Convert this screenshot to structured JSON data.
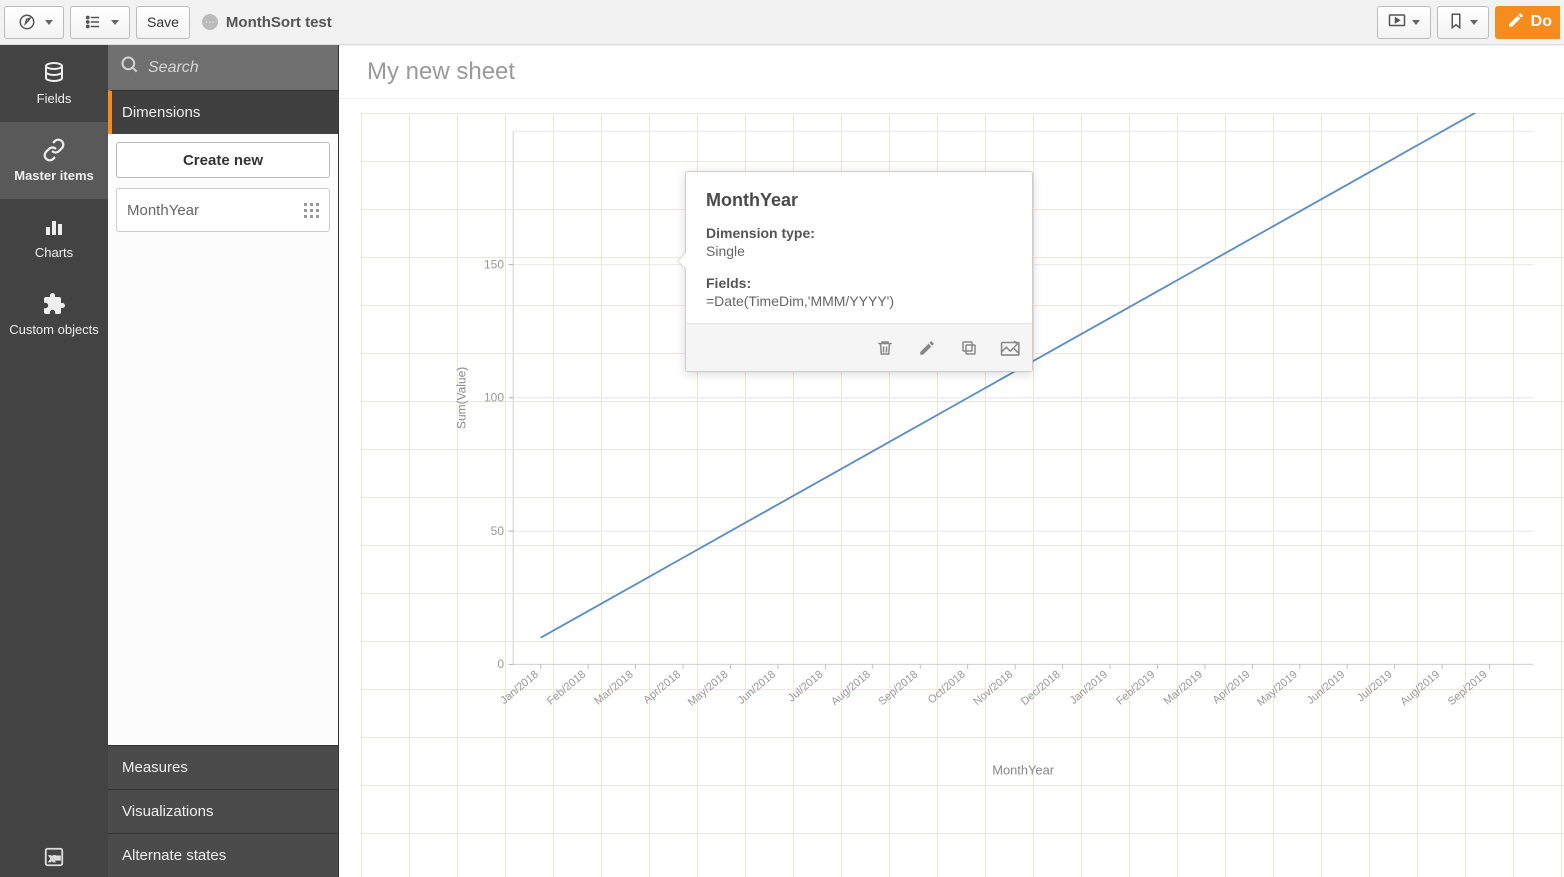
{
  "toolbar": {
    "save_label": "Save",
    "app_title": "MonthSort test",
    "done_label": "Do"
  },
  "iconbar": {
    "fields": "Fields",
    "master_items": "Master items",
    "charts": "Charts",
    "custom_objects": "Custom objects"
  },
  "assetpanel": {
    "search_placeholder": "Search",
    "dimensions_head": "Dimensions",
    "create_new_label": "Create new",
    "dim_item_label": "MonthYear",
    "measures_head": "Measures",
    "visualizations_head": "Visualizations",
    "alternate_states_head": "Alternate states"
  },
  "popover": {
    "title": "MonthYear",
    "type_label": "Dimension type:",
    "type_value": "Single",
    "fields_label": "Fields:",
    "fields_value": "=Date(TimeDim,'MMM/YYYY')"
  },
  "sheet": {
    "title": "My new sheet"
  },
  "chart_data": {
    "type": "line",
    "title": "",
    "xlabel": "MonthYear",
    "ylabel": "Sum(Value)",
    "ylim": [
      0,
      200
    ],
    "yticks": [
      0,
      50,
      100,
      150
    ],
    "categories": [
      "Jan/2018",
      "Feb/2018",
      "Mar/2018",
      "Apr/2018",
      "May/2018",
      "Jun/2018",
      "Jul/2018",
      "Aug/2018",
      "Sep/2018",
      "Oct/2018",
      "Nov/2018",
      "Dec/2018",
      "Jan/2019",
      "Feb/2019",
      "Mar/2019",
      "Apr/2019",
      "May/2019",
      "Jun/2019",
      "Jul/2019",
      "Aug/2019",
      "Sep/2019"
    ],
    "series": [
      {
        "name": "Sum(Value)",
        "color": "#5b8ec4",
        "values": [
          10,
          20,
          30,
          40,
          50,
          60,
          70,
          80,
          90,
          100,
          110,
          120,
          130,
          140,
          150,
          160,
          170,
          180,
          190,
          200,
          210
        ]
      }
    ]
  }
}
